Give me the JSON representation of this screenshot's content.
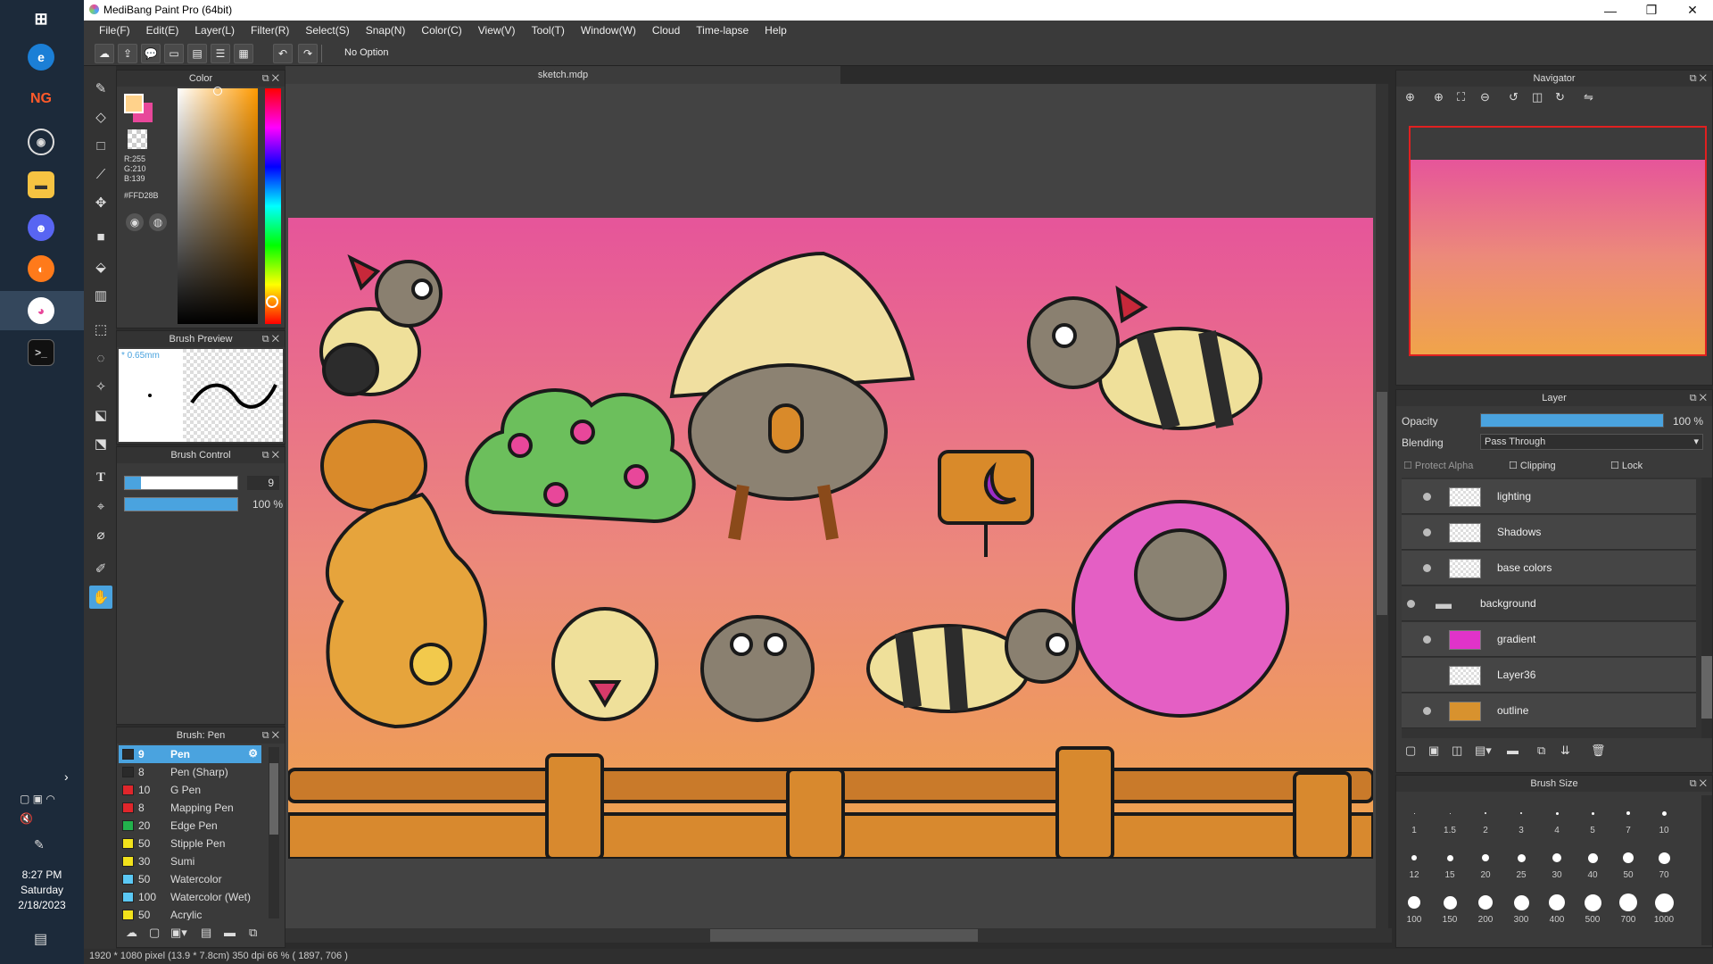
{
  "app": {
    "title": "MediBang Paint Pro (64bit)"
  },
  "menu": [
    "File(F)",
    "Edit(E)",
    "Layer(L)",
    "Filter(R)",
    "Select(S)",
    "Snap(N)",
    "Color(C)",
    "View(V)",
    "Tool(T)",
    "Window(W)",
    "Cloud",
    "Time-lapse",
    "Help"
  ],
  "toolbar": {
    "snap_option": "No Option"
  },
  "document": {
    "tab": "sketch.mdp"
  },
  "color_panel": {
    "title": "Color",
    "primary": "#FFD28B",
    "secondary": "#E8479A",
    "rgb": [
      "R:255",
      "G:210",
      "B:139"
    ],
    "hex": "#FFD28B"
  },
  "brush_preview": {
    "title": "Brush Preview",
    "size": "* 0.65mm"
  },
  "brush_control": {
    "title": "Brush Control",
    "size_value": "9",
    "opacity_value": "100 %"
  },
  "brush_list": {
    "title": "Brush: Pen",
    "items": [
      {
        "size": "9",
        "name": "Pen",
        "color": "#2a2a2a",
        "selected": true
      },
      {
        "size": "8",
        "name": "Pen (Sharp)",
        "color": "#2a2a2a"
      },
      {
        "size": "10",
        "name": "G Pen",
        "color": "#e0262b"
      },
      {
        "size": "8",
        "name": "Mapping Pen",
        "color": "#e0262b"
      },
      {
        "size": "20",
        "name": "Edge Pen",
        "color": "#22b14c"
      },
      {
        "size": "50",
        "name": "Stipple Pen",
        "color": "#f2e21b"
      },
      {
        "size": "30",
        "name": "Sumi",
        "color": "#f2e21b"
      },
      {
        "size": "50",
        "name": "Watercolor",
        "color": "#5bc8f5"
      },
      {
        "size": "100",
        "name": "Watercolor (Wet)",
        "color": "#5bc8f5"
      },
      {
        "size": "50",
        "name": "Acrylic",
        "color": "#f2e21b"
      }
    ]
  },
  "navigator": {
    "title": "Navigator"
  },
  "layer_panel": {
    "title": "Layer",
    "opacity_label": "Opacity",
    "opacity_value": "100 %",
    "opacity_fraction": 1.0,
    "blending_label": "Blending",
    "blending_value": "Pass Through",
    "protect_alpha": "Protect Alpha",
    "clipping": "Clipping",
    "lock": "Lock",
    "layers": [
      {
        "name": "lighting",
        "visible": true,
        "thumb": "checker"
      },
      {
        "name": "Shadows",
        "visible": true,
        "thumb": "checker"
      },
      {
        "name": "base colors",
        "visible": true,
        "thumb": "checker"
      },
      {
        "name": "background",
        "visible": true,
        "thumb": "folder"
      },
      {
        "name": "gradient",
        "visible": true,
        "thumb": "#e033c9"
      },
      {
        "name": "Layer36",
        "visible": false,
        "thumb": "checker"
      },
      {
        "name": "outline",
        "visible": true,
        "thumb": "#d8922e"
      }
    ]
  },
  "brush_size": {
    "title": "Brush Size",
    "sizes": [
      "1",
      "1.5",
      "2",
      "3",
      "4",
      "5",
      "7",
      "10",
      "12",
      "15",
      "20",
      "25",
      "30",
      "40",
      "50",
      "70",
      "100",
      "150",
      "200",
      "300",
      "400",
      "500",
      "700",
      "1000"
    ]
  },
  "status": {
    "text": "1920 * 1080 pixel   (13.9 * 7.8cm)   350 dpi   66 %   ( 1897, 706 )"
  },
  "taskbar": {
    "time": "8:27 PM",
    "day": "Saturday",
    "date": "2/18/2023",
    "icons": [
      "windows-icon",
      "edge-icon",
      "ng-icon",
      "obs-icon",
      "folder-icon",
      "discord-icon",
      "firefox-icon",
      "medibang-icon",
      "terminal-icon"
    ]
  }
}
